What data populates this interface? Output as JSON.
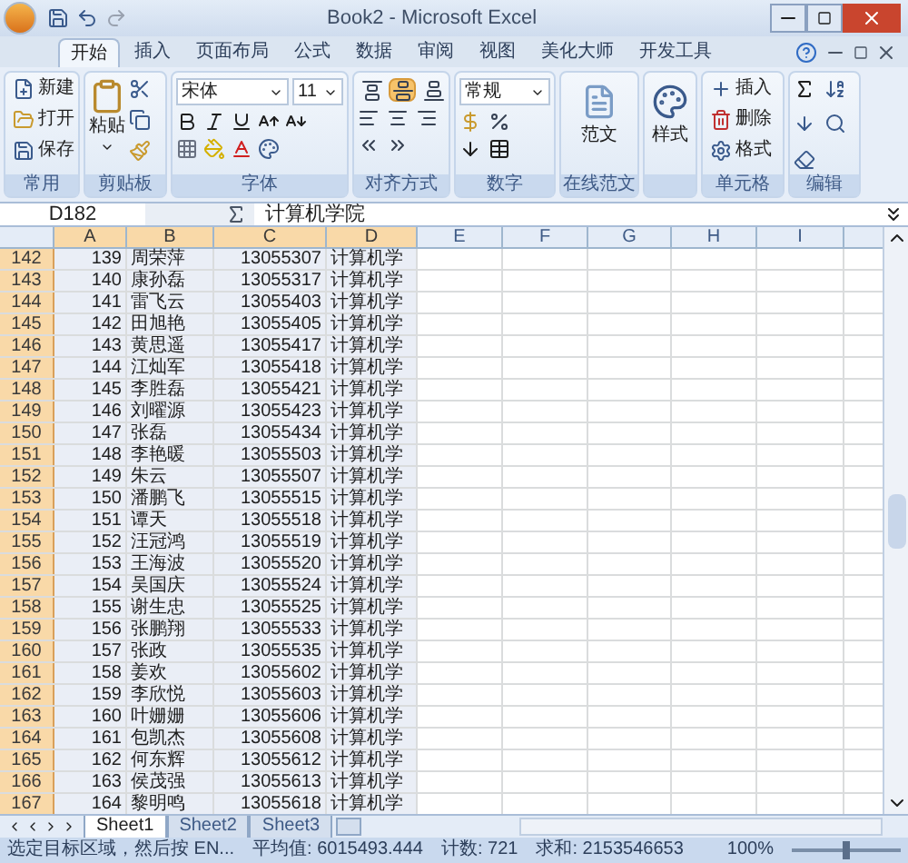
{
  "window": {
    "title": "Book2 - Microsoft Excel"
  },
  "tabs": [
    {
      "label": "开始",
      "selected": true
    },
    {
      "label": "插入",
      "selected": false
    },
    {
      "label": "页面布局",
      "selected": false
    },
    {
      "label": "公式",
      "selected": false
    },
    {
      "label": "数据",
      "selected": false
    },
    {
      "label": "审阅",
      "selected": false
    },
    {
      "label": "视图",
      "selected": false
    },
    {
      "label": "美化大师",
      "selected": false
    },
    {
      "label": "开发工具",
      "selected": false
    }
  ],
  "ribbon_groups": [
    {
      "kind": "common",
      "label": "常用",
      "items": [
        "新建",
        "打开",
        "保存"
      ]
    },
    {
      "kind": "clipboard",
      "label": "剪贴板",
      "items": [
        "粘贴"
      ]
    },
    {
      "kind": "font",
      "label": "字体",
      "font": "宋体",
      "size": "11"
    },
    {
      "kind": "align",
      "label": "对齐方式",
      "align_buttons": [
        {
          "selected": false
        },
        {
          "selected": true
        },
        {
          "selected": false
        }
      ]
    },
    {
      "kind": "number",
      "label": "数字",
      "format": "常规"
    },
    {
      "kind": "big",
      "label": "在线范文",
      "items": [
        "范文"
      ]
    },
    {
      "kind": "big",
      "items": [
        "样式"
      ]
    },
    {
      "kind": "cells",
      "label": "单元格",
      "items": [
        "插入",
        "删除",
        "格式"
      ]
    },
    {
      "kind": "edit",
      "label": "编辑"
    }
  ],
  "formula_bar": {
    "name_box": "D182",
    "value": "计算机学院"
  },
  "columns": [
    {
      "label": "A",
      "selected": true
    },
    {
      "label": "B",
      "selected": true
    },
    {
      "label": "C",
      "selected": true
    },
    {
      "label": "D",
      "selected": true
    },
    {
      "label": "E",
      "selected": false
    },
    {
      "label": "F",
      "selected": false
    },
    {
      "label": "G",
      "selected": false
    },
    {
      "label": "H",
      "selected": false
    },
    {
      "label": "I",
      "selected": false
    }
  ],
  "rows": [
    {
      "header": "142",
      "cells": [
        "139",
        "周荣萍",
        "13055307",
        "计算机学"
      ]
    },
    {
      "header": "143",
      "cells": [
        "140",
        "康孙磊",
        "13055317",
        "计算机学"
      ]
    },
    {
      "header": "144",
      "cells": [
        "141",
        "雷飞云",
        "13055403",
        "计算机学"
      ]
    },
    {
      "header": "145",
      "cells": [
        "142",
        "田旭艳",
        "13055405",
        "计算机学"
      ]
    },
    {
      "header": "146",
      "cells": [
        "143",
        "黄思遥",
        "13055417",
        "计算机学"
      ]
    },
    {
      "header": "147",
      "cells": [
        "144",
        "江灿军",
        "13055418",
        "计算机学"
      ]
    },
    {
      "header": "148",
      "cells": [
        "145",
        "李胜磊",
        "13055421",
        "计算机学"
      ]
    },
    {
      "header": "149",
      "cells": [
        "146",
        "刘曜源",
        "13055423",
        "计算机学"
      ]
    },
    {
      "header": "150",
      "cells": [
        "147",
        "张磊",
        "13055434",
        "计算机学"
      ]
    },
    {
      "header": "151",
      "cells": [
        "148",
        "李艳暖",
        "13055503",
        "计算机学"
      ]
    },
    {
      "header": "152",
      "cells": [
        "149",
        "朱云",
        "13055507",
        "计算机学"
      ]
    },
    {
      "header": "153",
      "cells": [
        "150",
        "潘鹏飞",
        "13055515",
        "计算机学"
      ]
    },
    {
      "header": "154",
      "cells": [
        "151",
        "谭天",
        "13055518",
        "计算机学"
      ]
    },
    {
      "header": "155",
      "cells": [
        "152",
        "汪冠鸿",
        "13055519",
        "计算机学"
      ]
    },
    {
      "header": "156",
      "cells": [
        "153",
        "王海波",
        "13055520",
        "计算机学"
      ]
    },
    {
      "header": "157",
      "cells": [
        "154",
        "吴国庆",
        "13055524",
        "计算机学"
      ]
    },
    {
      "header": "158",
      "cells": [
        "155",
        "谢生忠",
        "13055525",
        "计算机学"
      ]
    },
    {
      "header": "159",
      "cells": [
        "156",
        "张鹏翔",
        "13055533",
        "计算机学"
      ]
    },
    {
      "header": "160",
      "cells": [
        "157",
        "张政",
        "13055535",
        "计算机学"
      ]
    },
    {
      "header": "161",
      "cells": [
        "158",
        "姜欢",
        "13055602",
        "计算机学"
      ]
    },
    {
      "header": "162",
      "cells": [
        "159",
        "李欣悦",
        "13055603",
        "计算机学"
      ]
    },
    {
      "header": "163",
      "cells": [
        "160",
        "叶姗姗",
        "13055606",
        "计算机学"
      ]
    },
    {
      "header": "164",
      "cells": [
        "161",
        "包凯杰",
        "13055608",
        "计算机学"
      ]
    },
    {
      "header": "165",
      "cells": [
        "162",
        "何东辉",
        "13055612",
        "计算机学"
      ]
    },
    {
      "header": "166",
      "cells": [
        "163",
        "侯茂强",
        "13055613",
        "计算机学"
      ]
    },
    {
      "header": "167",
      "cells": [
        "164",
        "黎明鸣",
        "13055618",
        "计算机学"
      ]
    }
  ],
  "sheets": [
    {
      "label": "Sheet1",
      "selected": true
    },
    {
      "label": "Sheet2",
      "selected": false
    },
    {
      "label": "Sheet3",
      "selected": false
    }
  ],
  "status_bar": {
    "message": "选定目标区域，然后按 EN...",
    "average": "平均值: 6015493.444",
    "count": "计数: 721",
    "sum": "求和: 2153546653",
    "zoom": "100%",
    "zoom_level": {
      "level": 0.5
    }
  }
}
